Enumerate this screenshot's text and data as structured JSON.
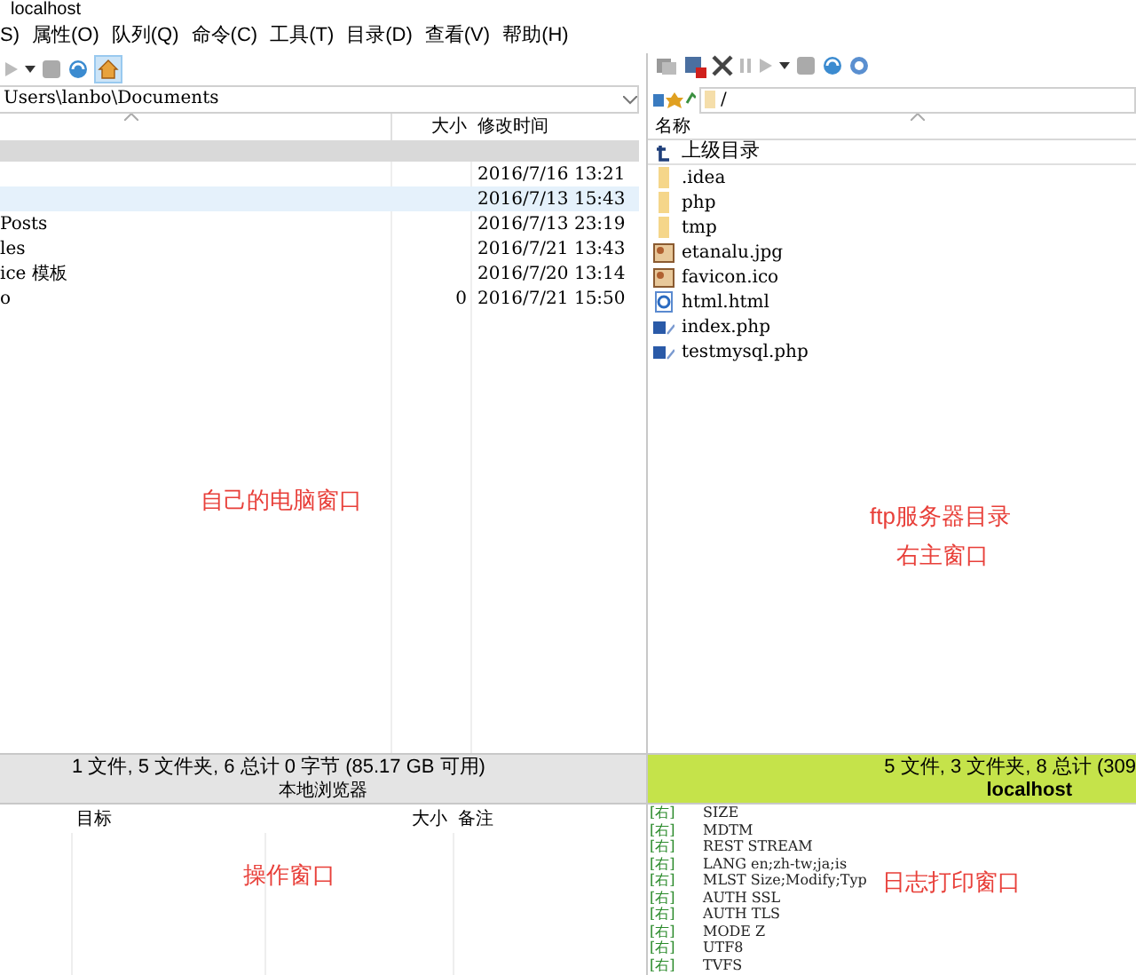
{
  "window": {
    "title": "localhost"
  },
  "menu": [
    "S)",
    "属性(O)",
    "队列(Q)",
    "命令(C)",
    "工具(T)",
    "目录(D)",
    "查看(V)",
    "帮助(H)"
  ],
  "local": {
    "path": "Users\\lanbo\\Documents",
    "columns": [
      "大小",
      "修改时间"
    ],
    "rows": [
      {
        "name": "",
        "size": "",
        "modified": "2016/7/16 13:21",
        "selected": false
      },
      {
        "name": "",
        "size": "",
        "modified": "2016/7/13 15:43",
        "selected": true
      },
      {
        "name": "Posts",
        "size": "",
        "modified": "2016/7/13 23:19",
        "selected": false
      },
      {
        "name": "les",
        "size": "",
        "modified": "2016/7/21 13:43",
        "selected": false
      },
      {
        "name": "ice 模板",
        "size": "",
        "modified": "2016/7/20 13:14",
        "selected": false
      },
      {
        "name": "o",
        "size": "0",
        "modified": "2016/7/21 15:50",
        "selected": false
      }
    ],
    "status": "1 文件, 5 文件夹, 6 总计 0 字节 (85.17 GB 可用)",
    "caption": "本地浏览器"
  },
  "remote": {
    "path": "/",
    "columns": [
      "名称"
    ],
    "rows": [
      {
        "kind": "parent",
        "name": "上级目录"
      },
      {
        "kind": "folder",
        "name": ".idea"
      },
      {
        "kind": "folder",
        "name": "php"
      },
      {
        "kind": "folder",
        "name": "tmp"
      },
      {
        "kind": "image",
        "name": "etanalu.jpg"
      },
      {
        "kind": "image",
        "name": "favicon.ico"
      },
      {
        "kind": "html",
        "name": "html.html"
      },
      {
        "kind": "php",
        "name": "index.php"
      },
      {
        "kind": "php",
        "name": "testmysql.php"
      }
    ],
    "status": "5 文件, 3 文件夹, 8 总计 (309",
    "caption": "localhost"
  },
  "queue": {
    "columns": [
      "目标",
      "大小",
      "备注"
    ]
  },
  "log": [
    {
      "side": "[右]",
      "text": "SIZE"
    },
    {
      "side": "[右]",
      "text": "MDTM"
    },
    {
      "side": "[右]",
      "text": "REST STREAM"
    },
    {
      "side": "[右]",
      "text": "LANG en;zh-tw;ja;is"
    },
    {
      "side": "[右]",
      "text": "MLST Size;Modify;Typ"
    },
    {
      "side": "[右]",
      "text": "AUTH SSL"
    },
    {
      "side": "[右]",
      "text": "AUTH TLS"
    },
    {
      "side": "[右]",
      "text": "MODE Z"
    },
    {
      "side": "[右]",
      "text": "UTF8"
    },
    {
      "side": "[右]",
      "text": "TVFS"
    }
  ],
  "annotations": {
    "local": "自己的电脑窗口",
    "remote": [
      "ftp服务器目录",
      "右主窗口"
    ],
    "queue": "操作窗口",
    "log": "日志打印窗口"
  }
}
